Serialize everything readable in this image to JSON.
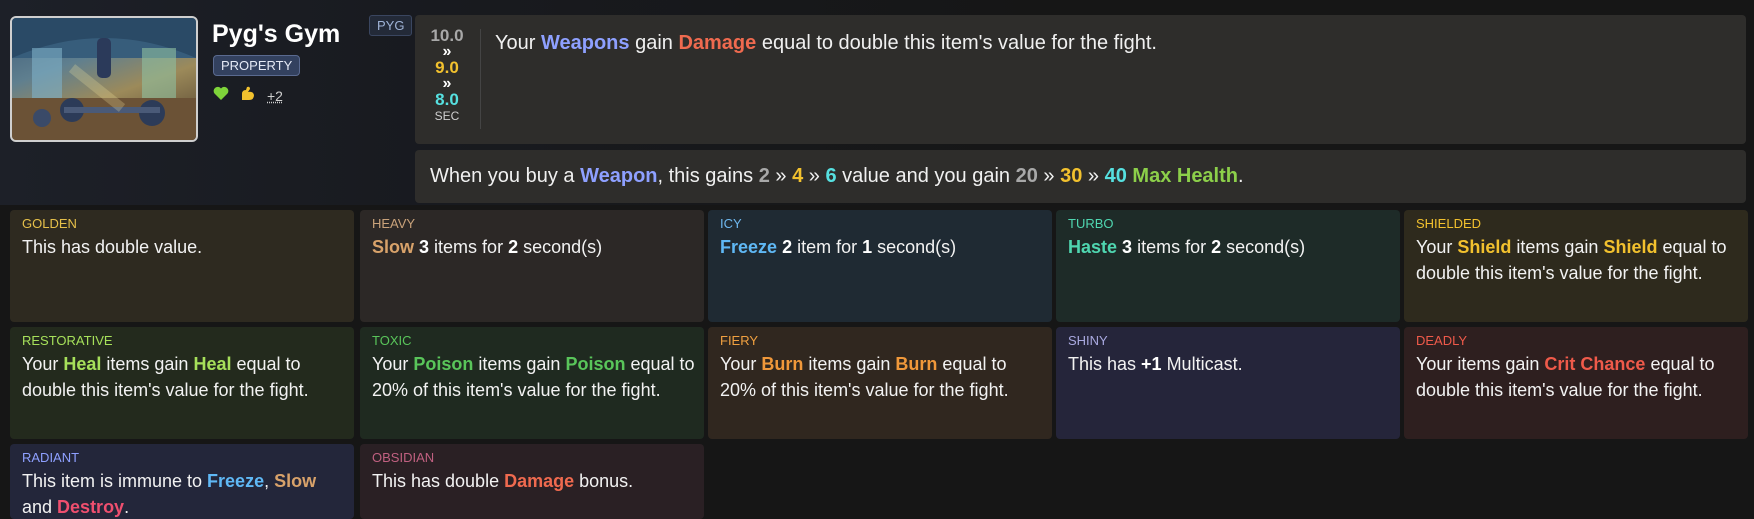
{
  "item": {
    "name": "Pyg's Gym",
    "tag": "PYG",
    "type": "PROPERTY",
    "extra_tags": "+2",
    "icons": [
      "heart-icon",
      "bicep-icon"
    ],
    "image_icon": "gym-room-image"
  },
  "cooldown": {
    "tier1": "10.0",
    "tier2": "9.0",
    "tier3": "8.0",
    "sep": "»",
    "unit": "SEC"
  },
  "main_ability": {
    "p1": "Your ",
    "kw1": "Weapons",
    "p2": " gain ",
    "kw2": "Damage",
    "p3": " equal to double this item's value for the fight."
  },
  "sub_ability": {
    "p1": "When you buy a ",
    "kw1": "Weapon",
    "p2": ", this gains ",
    "v1": "2",
    "v2": "4",
    "v3": "6",
    "p3": " value and you gain ",
    "h1": "20",
    "h2": "30",
    "h3": "40",
    "kw2": "Max Health",
    "end": ".",
    "sep": " » "
  },
  "enchantments": [
    {
      "name": "GOLDEN",
      "parts": [
        "This has double value."
      ]
    },
    {
      "name": "HEAVY",
      "parts": [
        "Slow",
        " ",
        "3",
        " items for ",
        "2",
        " second(s)"
      ]
    },
    {
      "name": "ICY",
      "parts": [
        "Freeze",
        " ",
        "2",
        " item for ",
        "1",
        " second(s)"
      ]
    },
    {
      "name": "TURBO",
      "parts": [
        "Haste",
        " ",
        "3",
        " items for ",
        "2",
        " second(s)"
      ]
    },
    {
      "name": "SHIELDED",
      "parts": [
        "Your ",
        "Shield",
        " items gain ",
        "Shield",
        " equal to double this item's value for the fight."
      ]
    },
    {
      "name": "RESTORATIVE",
      "parts": [
        "Your ",
        "Heal",
        " items gain ",
        "Heal",
        " equal to double this item's value for the fight."
      ]
    },
    {
      "name": "TOXIC",
      "parts": [
        "Your ",
        "Poison",
        " items gain ",
        "Poison",
        " equal to 20% of this item's value for the fight."
      ]
    },
    {
      "name": "FIERY",
      "parts": [
        "Your ",
        "Burn",
        " items gain ",
        "Burn",
        " equal to 20% of this item's value for the fight."
      ]
    },
    {
      "name": "SHINY",
      "parts": [
        "This has ",
        "+1",
        " Multicast."
      ]
    },
    {
      "name": "DEADLY",
      "parts": [
        "Your items gain ",
        "Crit Chance",
        " equal to double this item's value for the fight."
      ]
    },
    {
      "name": "RADIANT",
      "parts": [
        "This item is immune to ",
        "Freeze",
        ", ",
        "Slow",
        " and ",
        "Destroy",
        "."
      ]
    },
    {
      "name": "OBSIDIAN",
      "parts": [
        "This has double ",
        "Damage",
        " bonus."
      ]
    }
  ],
  "colors": {
    "background": "#161616",
    "card": "#2e2d2b",
    "weapon": "#8ea0ff",
    "damage": "#ef6a4f",
    "gold": "#f2c12e",
    "cyan": "#56e0e0",
    "max_health": "#8ccf4a"
  }
}
